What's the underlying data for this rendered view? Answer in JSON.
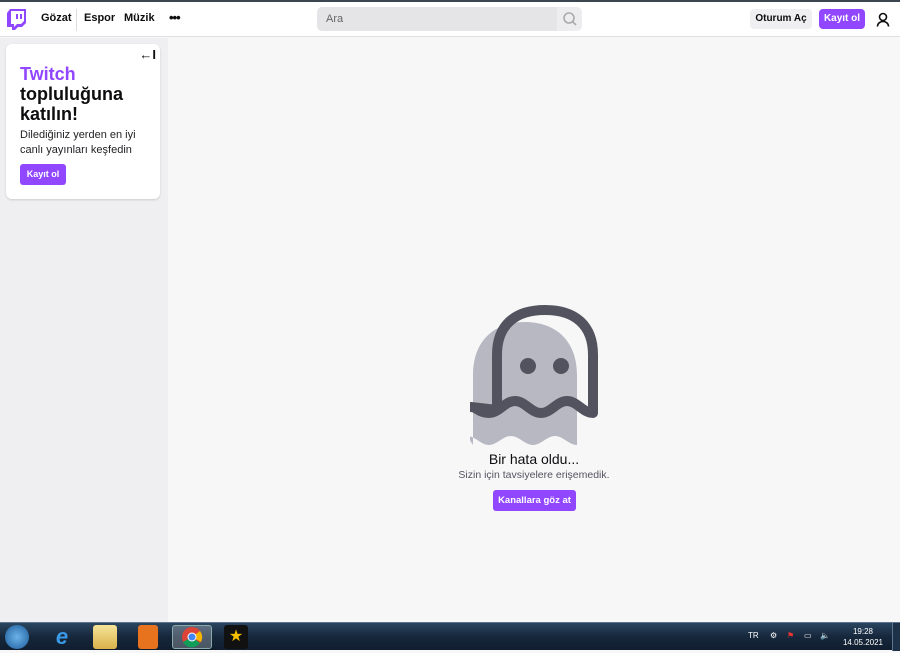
{
  "header": {
    "nav": [
      "Gözat",
      "Espor",
      "Müzik"
    ],
    "more": "•••",
    "search_placeholder": "Ara",
    "login": "Oturum Aç",
    "signup": "Kayıt ol"
  },
  "sidebar": {
    "collapse": "←I",
    "title_brand": "Twitch",
    "title_rest": "topluluğuna katılın!",
    "description": "Dilediğiniz yerden en iyi canlı yayınları keşfedin",
    "button": "Kayıt ol"
  },
  "error": {
    "title": "Bir hata oldu...",
    "subtitle": "Sizin için tavsiyelere erişemedik.",
    "button": "Kanallara göz at"
  },
  "taskbar": {
    "lang": "TR",
    "time": "19:28",
    "date": "14.05.2021"
  },
  "colors": {
    "accent": "#9147ff"
  }
}
